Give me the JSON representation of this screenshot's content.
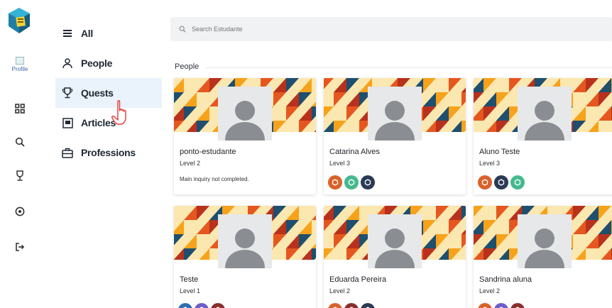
{
  "rail": {
    "profile_label": "Profile",
    "icons": [
      "apps-grid-icon",
      "search-icon",
      "trophy-icon",
      "help-circle-icon",
      "logout-icon"
    ]
  },
  "menu": {
    "items": [
      {
        "label": "All",
        "icon": "list-icon",
        "active": false
      },
      {
        "label": "People",
        "icon": "people-icon",
        "active": false
      },
      {
        "label": "Quests",
        "icon": "trophy-icon",
        "active": true
      },
      {
        "label": "Articles",
        "icon": "article-icon",
        "active": false
      },
      {
        "label": "Professions",
        "icon": "briefcase-icon",
        "active": false
      }
    ]
  },
  "search": {
    "placeholder": "Search Estudante"
  },
  "section": {
    "title": "People"
  },
  "cards": [
    {
      "name": "ponto-estudante",
      "level": "Level 2",
      "note": "Main inquiry not completed.",
      "badges": []
    },
    {
      "name": "Catarina Alves",
      "level": "Level 3",
      "note": "",
      "badges": [
        "#d9622b",
        "#45b98f",
        "#2b3a55"
      ]
    },
    {
      "name": "Aluno Teste",
      "level": "Level 3",
      "note": "",
      "badges": [
        "#d9622b",
        "#2b3a55",
        "#45b98f"
      ]
    },
    {
      "name": "Teste",
      "level": "Level 1",
      "note": "",
      "badges": [
        "#2e6fb3",
        "#6b5fc7",
        "#8a2e2e"
      ]
    },
    {
      "name": "Eduarda Pereira",
      "level": "Level 2",
      "note": "",
      "badges": [
        "#d9622b",
        "#8a2e2e",
        "#2b3a55"
      ]
    },
    {
      "name": "Sandrina aluna",
      "level": "Level 2",
      "note": "",
      "badges": [
        "#d9622b",
        "#6b5fc7",
        "#8a2e2e"
      ]
    }
  ],
  "colors": {
    "accent": "#3a66a8",
    "menu_active_bg": "#eaf2fb",
    "banner_palette": [
      "#f7a21b",
      "#e5571f",
      "#1e4f6e",
      "#fbe7b0",
      "#b8311c"
    ]
  }
}
